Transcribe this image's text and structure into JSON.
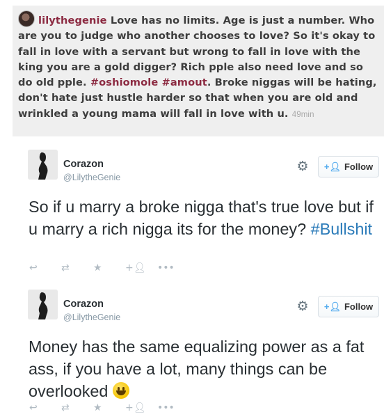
{
  "comment": {
    "username": "lilythegenie",
    "text_before_tags": "Love has no limits. Age is just a number. Who are you to judge who another chooses to love? So it's okay to fall in love with a servant but wrong to fall in love with the king you are a gold digger? Rich pple also need love and so do old pple.",
    "tag1": "#oshiomole",
    "tag2": "#amout",
    "text_after_tags": ". Broke niggas will be hating, don't hate just hustle harder so that when you are old and wrinkled a young mama will fall in love with u.",
    "time": "49min"
  },
  "tweets": [
    {
      "name": "Corazon",
      "handle": "@LilytheGenie",
      "follow_label": "Follow",
      "text": "So if u marry a broke nigga that's true love but if u marry a rich nigga its for the money?",
      "hashtag": "#Bullshit"
    },
    {
      "name": "Corazon",
      "handle": "@LilytheGenie",
      "follow_label": "Follow",
      "text": "Money has the same equalizing power as a fat ass, if you have a lot, many things can be overlooked"
    }
  ],
  "icons": {
    "reply": "reply-icon",
    "retweet": "retweet-icon",
    "favorite": "star-icon",
    "follow": "follow-plus-icon",
    "more": "more-icon",
    "settings": "gear-icon"
  },
  "colors": {
    "username": "#8c2b42",
    "hashtag": "#2b7bb9",
    "follow_accent": "#55acee",
    "comment_bg": "#efefef"
  }
}
